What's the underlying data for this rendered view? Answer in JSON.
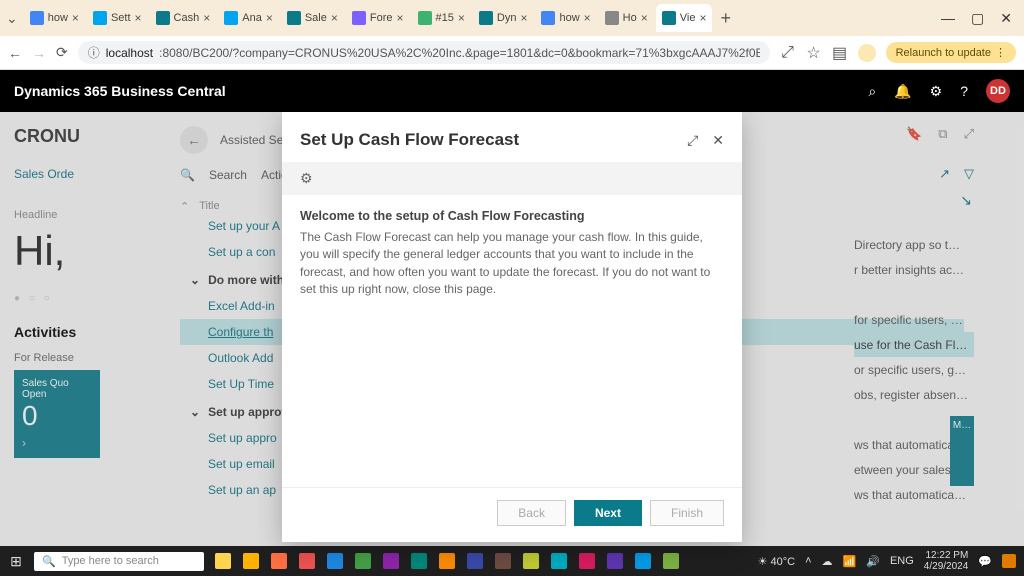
{
  "browser": {
    "tabs": [
      {
        "label": "how",
        "favicon": "#4285f4"
      },
      {
        "label": "Sett",
        "favicon": "#00a4ef"
      },
      {
        "label": "Cash",
        "favicon": "#0b7a8a"
      },
      {
        "label": "Ana",
        "favicon": "#00a4ef"
      },
      {
        "label": "Sale",
        "favicon": "#0b7a8a"
      },
      {
        "label": "Fore",
        "favicon": "#7b61ff"
      },
      {
        "label": "#15",
        "favicon": "#3cb371"
      },
      {
        "label": "Dyn",
        "favicon": "#0b7a8a"
      },
      {
        "label": "how",
        "favicon": "#4285f4"
      },
      {
        "label": "Ho",
        "favicon": "#888"
      },
      {
        "label": "Vie",
        "favicon": "#0b7a8a",
        "active": true
      }
    ],
    "url_prefix": "localhost",
    "url_rest": ":8080/BC200/?company=CRONUS%20USA%2C%20Inc.&page=1801&dc=0&bookmark=71%3bxgcAAAJ7%2f0EAUwBTAE…",
    "relaunch": "Relaunch to update"
  },
  "bc": {
    "product": "Dynamics 365 Business Central",
    "avatar": "DD"
  },
  "page": {
    "company": "CRONU",
    "role": "Sales Orde",
    "headline_label": "Headline",
    "greeting": "Hi,",
    "activities": "Activities",
    "for_release": "For Release",
    "tile_title": "Sales Quo",
    "tile_sub": "Open",
    "tile_value": "0",
    "m_tile": "M…",
    "breadcrumb": "Assisted Setup | Wor",
    "search": "Search",
    "actions": "Actio",
    "title_hdr": "Title",
    "groups": [
      {
        "label": "Set up your A",
        "type": "item"
      },
      {
        "label": "Set up a con",
        "type": "item"
      },
      {
        "label": "Do more with",
        "type": "group"
      },
      {
        "label": "Excel Add-in",
        "type": "item"
      },
      {
        "label": "Configure th",
        "type": "item",
        "highlight": true
      },
      {
        "label": "Outlook Add",
        "type": "item"
      },
      {
        "label": "Set Up Time",
        "type": "item"
      },
      {
        "label": "Set up approv",
        "type": "group"
      },
      {
        "label": "Set up appro",
        "type": "item"
      },
      {
        "label": "Set up email",
        "type": "item"
      },
      {
        "label": "Set up an ap",
        "type": "item"
      }
    ],
    "descs": [
      "Directory app so t…",
      "r better insights ac…",
      "",
      "for specific users, …",
      "use for the Cash Fl…",
      "or specific users, g…",
      "obs, register absen…",
      "",
      "ws that automatica…",
      "etween your sales t…",
      "ws that automatica…"
    ]
  },
  "modal": {
    "title": "Set Up Cash Flow Forecast",
    "welcome": "Welcome to the setup of Cash Flow Forecasting",
    "body": "The Cash Flow Forecast can help you manage your cash flow. In this guide, you will specify the general ledger accounts that you want to include in the forecast, and how often you want to update the forecast. If you do not want to set this up right now, close this page.",
    "back": "Back",
    "next": "Next",
    "finish": "Finish"
  },
  "taskbar": {
    "search_placeholder": "Type here to search",
    "temp": "40°C",
    "lang": "ENG",
    "time": "12:22 PM",
    "date": "4/29/2024"
  }
}
